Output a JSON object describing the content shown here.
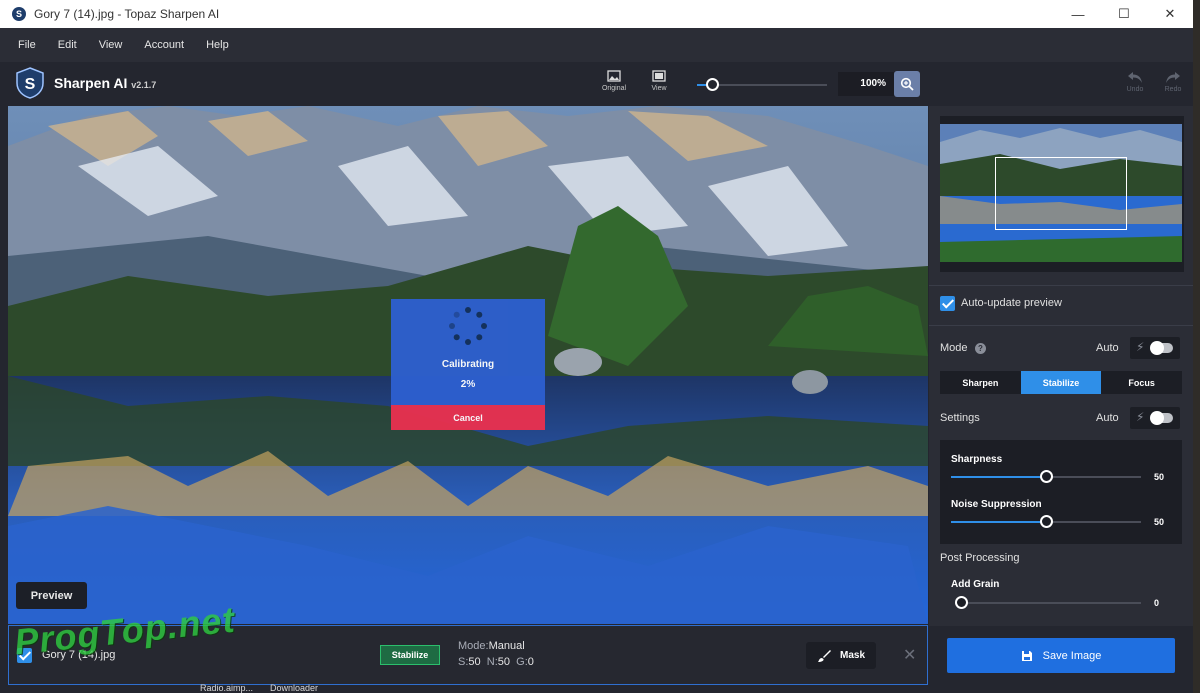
{
  "window": {
    "title": "Gory 7 (14).jpg - Topaz Sharpen AI",
    "controls": [
      "minimize-icon",
      "maximize-icon",
      "close-icon"
    ]
  },
  "menu": [
    "File",
    "Edit",
    "View",
    "Account",
    "Help"
  ],
  "toolbar": {
    "app_name": "Sharpen AI",
    "version": "v2.1.7",
    "original_label": "Original",
    "view_label": "View",
    "zoom_value": "100%",
    "zoom_slider_level": 0.1,
    "undo_label": "Undo",
    "redo_label": "Redo"
  },
  "progress": {
    "status": "Calibrating",
    "percent": "2%",
    "cancel_label": "Cancel"
  },
  "canvas": {
    "preview_label": "Preview"
  },
  "panel": {
    "auto_update_label": "Auto-update preview",
    "auto_update_checked": true,
    "mode_label": "Mode",
    "mode_auto_label": "Auto",
    "mode_tabs": [
      "Sharpen",
      "Stabilize",
      "Focus"
    ],
    "mode_active": "Stabilize",
    "settings_label": "Settings",
    "settings_auto_label": "Auto",
    "sliders": [
      {
        "label": "Sharpness",
        "value": "50"
      },
      {
        "label": "Noise Suppression",
        "value": "50"
      }
    ],
    "post_processing_label": "Post Processing",
    "grain_label": "Add Grain",
    "grain_value": "0"
  },
  "bottom": {
    "file_name": "Gory 7 (14).jpg",
    "mode_badge": "Stabilize",
    "mode_prefix": "Mode:",
    "mode_value": "Manual",
    "s_label": "S:",
    "s_value": "50",
    "n_label": "N:",
    "n_value": "50",
    "g_label": "G:",
    "g_value": "0",
    "mask_label": "Mask",
    "save_label": "Save Image"
  },
  "watermark": "ProgTop.net",
  "taskbar": [
    "Radio.aimp...",
    "Downloader"
  ],
  "colors": {
    "accent": "#2f8fe8",
    "cancel": "#e8314f",
    "badge": "#2bbf6c",
    "panel_bg": "#2b2d36",
    "dialog": "#2d5fcf"
  }
}
